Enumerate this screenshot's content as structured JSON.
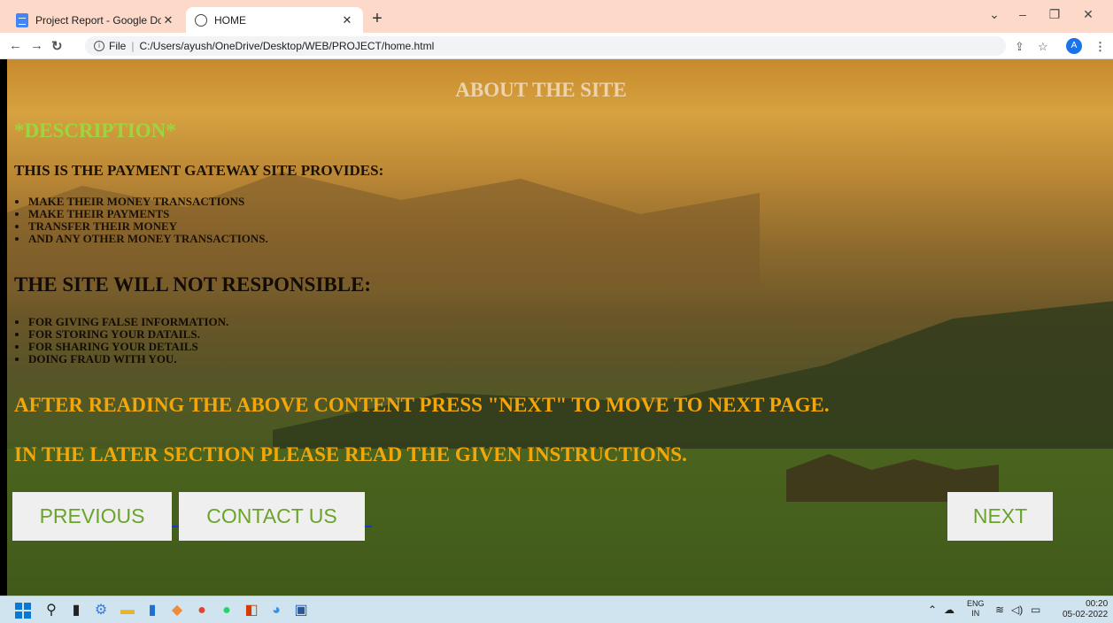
{
  "browser": {
    "tabs": [
      {
        "title": "Project Report - Google Docs",
        "icon": "google-docs-icon"
      },
      {
        "title": "HOME",
        "icon": "globe-icon",
        "active": true
      }
    ],
    "url_prefix": "File",
    "url": "C:/Users/ayush/OneDrive/Desktop/WEB/PROJECT/home.html",
    "profile_initial": "A"
  },
  "page": {
    "heading": "ABOUT THE SITE",
    "description_heading": "*DESCRIPTION*",
    "provides_heading": "THIS IS THE PAYMENT GATEWAY SITE PROVIDES:",
    "provides_items": [
      "MAKE THEIR MONEY TRANSACTIONS",
      "MAKE THEIR PAYMENTS",
      "TRANSFER THEIR MONEY",
      "AND ANY OTHER MONEY TRANSACTIONS."
    ],
    "not_responsible_heading": "THE SITE WILL NOT RESPONSIBLE:",
    "not_responsible_items": [
      "FOR GIVING FALSE INFORMATION.",
      "FOR STORING YOUR DATAILS.",
      "FOR SHARING YOUR DETAILS",
      "DOING FRAUD WITH YOU."
    ],
    "after_reading": "AFTER READING THE ABOVE CONTENT PRESS \"NEXT\" TO MOVE TO NEXT PAGE.",
    "later_section": "IN THE LATER SECTION PLEASE READ THE GIVEN INSTRUCTIONS.",
    "buttons": {
      "previous": "PREVIOUS",
      "contact": "CONTACT US",
      "next": "NEXT"
    }
  },
  "taskbar": {
    "lang_top": "ENG",
    "lang_bottom": "IN",
    "time": "00:20",
    "date": "05-02-2022"
  },
  "colors": {
    "heading_beige": "#ecd3b0",
    "description_green": "#9bd640",
    "instruction_orange": "#f2a60a",
    "button_text_green": "#6aa42a",
    "tabbar_peach": "#fcd9c8"
  }
}
